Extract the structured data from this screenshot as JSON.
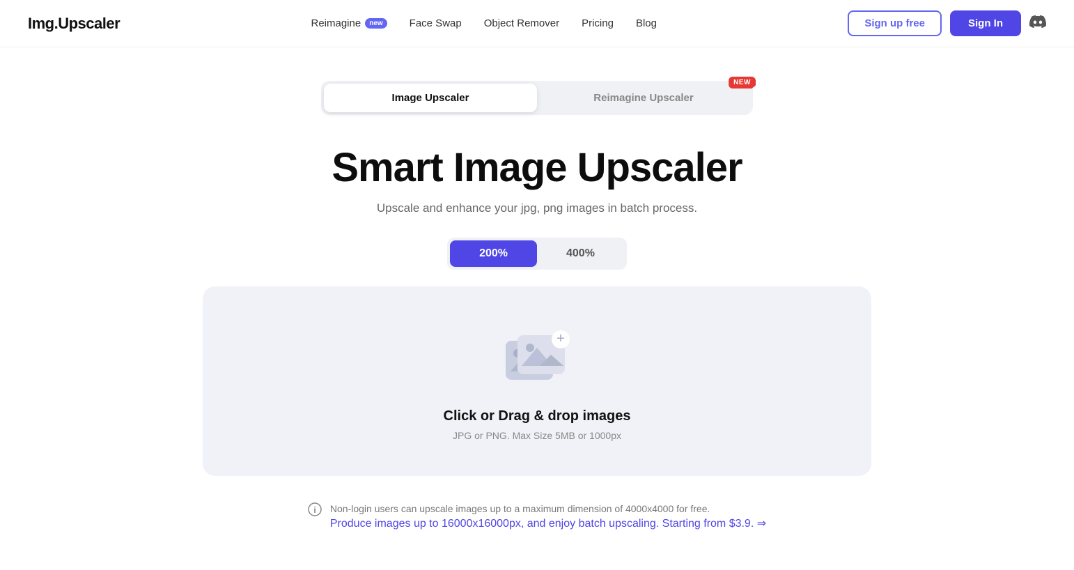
{
  "brand": {
    "logo": "Img.Upscaler"
  },
  "nav": {
    "links": [
      {
        "id": "reimagine",
        "label": "Reimagine",
        "badge": "new"
      },
      {
        "id": "face-swap",
        "label": "Face Swap"
      },
      {
        "id": "object-remover",
        "label": "Object Remover"
      },
      {
        "id": "pricing",
        "label": "Pricing"
      },
      {
        "id": "blog",
        "label": "Blog"
      }
    ],
    "signup_label": "Sign up free",
    "signin_label": "Sign In"
  },
  "tabs": [
    {
      "id": "image-upscaler",
      "label": "Image Upscaler",
      "active": true
    },
    {
      "id": "reimagine-upscaler",
      "label": "Reimagine Upscaler",
      "active": false,
      "badge": "NEW"
    }
  ],
  "hero": {
    "title": "Smart Image Upscaler",
    "subtitle": "Upscale and enhance your jpg, png images in batch process."
  },
  "scale": {
    "options": [
      {
        "id": "200",
        "label": "200%",
        "active": true
      },
      {
        "id": "400",
        "label": "400%",
        "active": false
      }
    ]
  },
  "dropzone": {
    "title": "Click or Drag & drop images",
    "subtitle": "JPG or PNG. Max Size 5MB or 1000px"
  },
  "info": {
    "text": "Non-login users can upscale images up to a maximum dimension of 4000x4000 for free.",
    "link_text": "Produce images up to 16000x16000px, and enjoy batch upscaling. Starting from $3.9. ⇒"
  }
}
